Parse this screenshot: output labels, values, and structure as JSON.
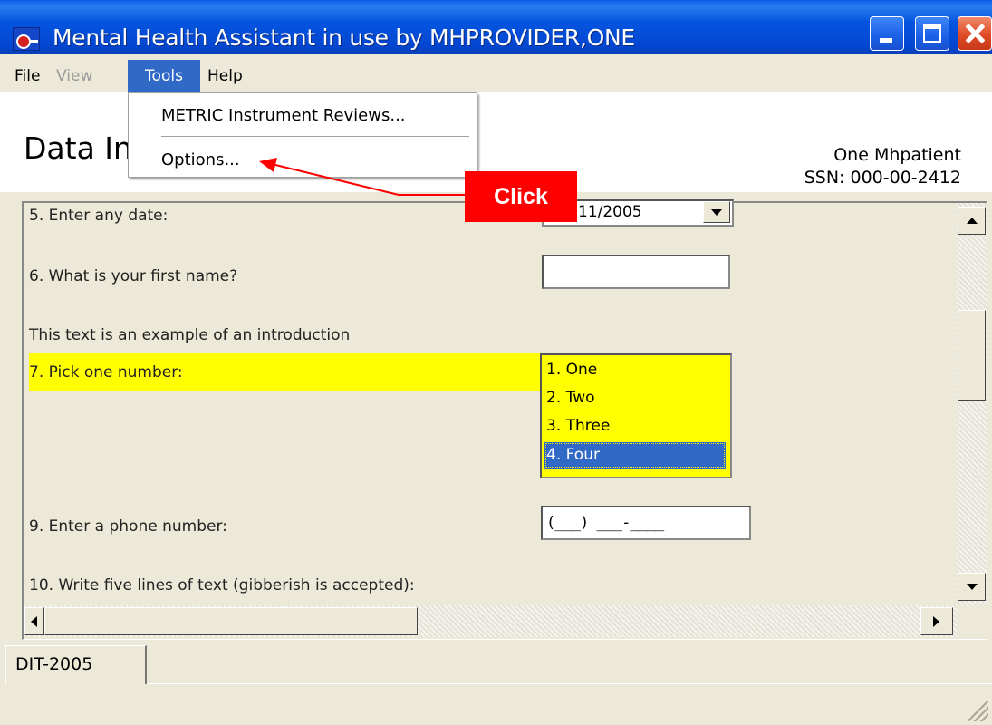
{
  "window": {
    "title": "Mental Health Assistant in use by MHPROVIDER,ONE"
  },
  "menubar": {
    "file": "File",
    "view": "View",
    "tools": "Tools",
    "help": "Help"
  },
  "tools_menu": {
    "metric_reviews": "METRIC Instrument Reviews...",
    "options": "Options..."
  },
  "header": {
    "title": "Data In",
    "patient_name": "One Mhpatient",
    "patient_ssn": "SSN: 000-00-2412"
  },
  "form": {
    "q5_label": "5. Enter any date:",
    "q5_value": "11/2005",
    "q6_label": "6. What is your first name?",
    "q6_value": "",
    "intro_text": "This text is an example of an introduction",
    "q7_label": "7. Pick one number:",
    "q7_options": [
      "1. One",
      "2. Two",
      "3. Three",
      "4. Four"
    ],
    "q7_selected": "4. Four",
    "q9_label": "9. Enter a phone number:",
    "q9_value": "(___) ___-____",
    "q10_label": "10. Write five lines of text (gibberish is accepted):"
  },
  "tabs": {
    "active": "DIT-2005"
  },
  "annotation": {
    "label": "Click"
  },
  "colors": {
    "highlight": "#ffff00",
    "selection": "#3169c6",
    "annotation": "#ff0000",
    "titlebar": "#0555e0"
  }
}
